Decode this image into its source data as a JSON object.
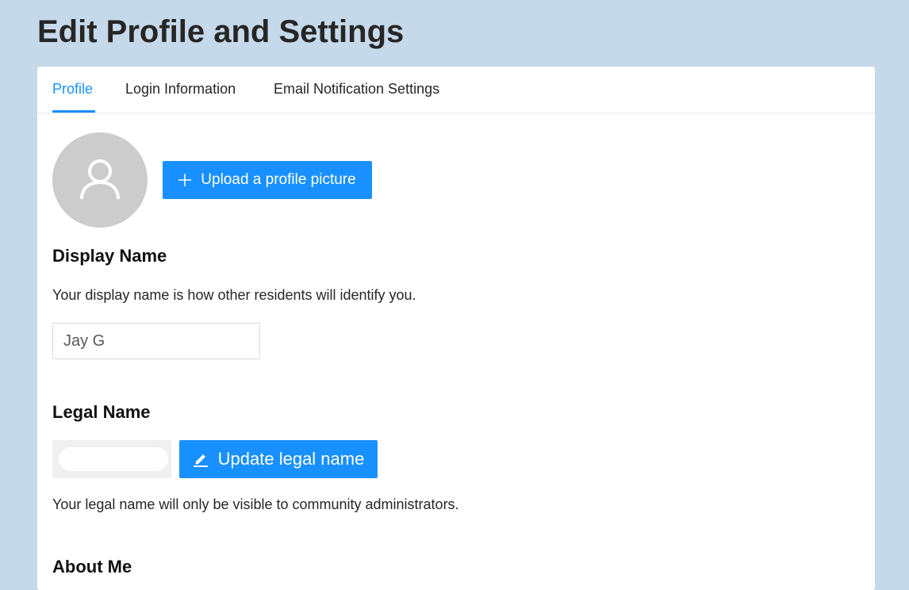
{
  "page": {
    "title": "Edit Profile and Settings"
  },
  "tabs": [
    {
      "label": "Profile",
      "active": true
    },
    {
      "label": "Login Information",
      "active": false
    },
    {
      "label": "Email Notification Settings",
      "active": false
    }
  ],
  "profile": {
    "avatar_icon": "user-icon",
    "upload_label": "Upload a profile picture",
    "upload_icon": "plus-icon"
  },
  "display_name": {
    "heading": "Display Name",
    "help": "Your display name is how other residents will identify you.",
    "value": "Jay G"
  },
  "legal_name": {
    "heading": "Legal Name",
    "update_label": "Update legal name",
    "update_icon": "edit-icon",
    "help": "Your legal name will only be visible to community administrators."
  },
  "about_me": {
    "heading": "About Me"
  },
  "colors": {
    "background": "#c6d9ea",
    "accent": "#1890ff",
    "avatar": "#cccccc"
  }
}
